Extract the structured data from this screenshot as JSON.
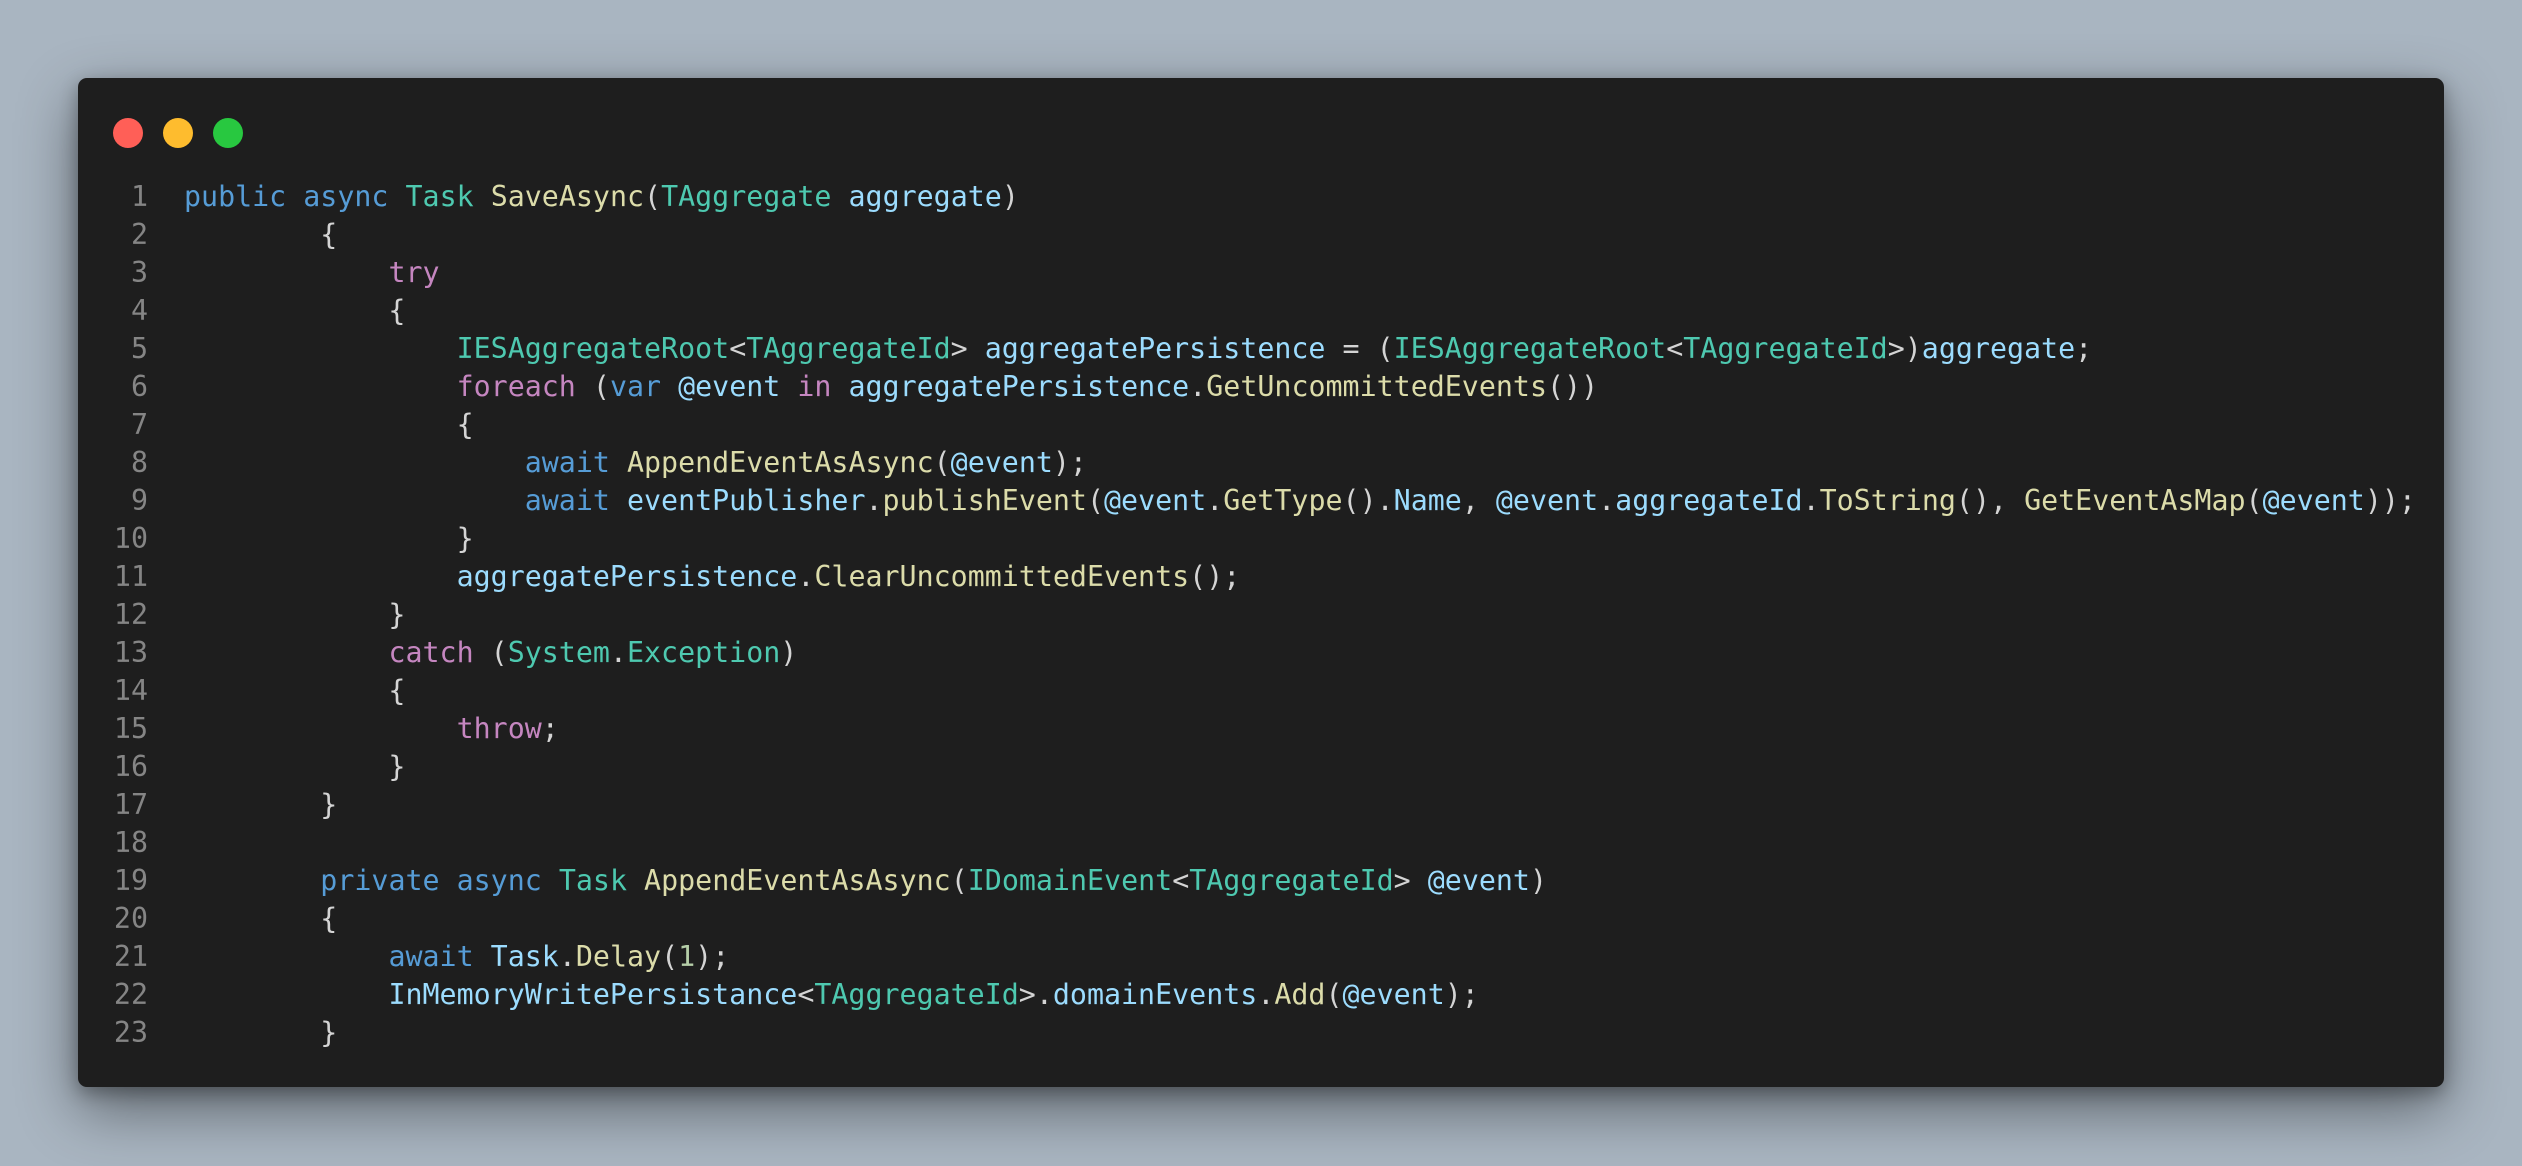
{
  "window": {
    "controls": [
      "close",
      "minimize",
      "maximize"
    ]
  },
  "colors": {
    "background": "#a9b5c1",
    "editor": "#1e1e1e",
    "close": "#ff5f57",
    "minimize": "#febc2e",
    "maximize": "#28c840",
    "keyword": "#569cd6",
    "control": "#c586c0",
    "type": "#4ec9b0",
    "function": "#dcdcaa",
    "identifier": "#9cdcfe",
    "number": "#b5cea8",
    "plain": "#d4d4d4",
    "line_number": "#858585"
  },
  "code": {
    "lines": [
      {
        "n": "1",
        "tokens": [
          [
            "kw",
            "public"
          ],
          [
            "pn",
            " "
          ],
          [
            "kw",
            "async"
          ],
          [
            "pn",
            " "
          ],
          [
            "ty",
            "Task"
          ],
          [
            "pn",
            " "
          ],
          [
            "fn",
            "SaveAsync"
          ],
          [
            "pn",
            "("
          ],
          [
            "ty",
            "TAggregate"
          ],
          [
            "pn",
            " "
          ],
          [
            "id",
            "aggregate"
          ],
          [
            "pn",
            ")"
          ]
        ]
      },
      {
        "n": "2",
        "tokens": [
          [
            "pn",
            "        {"
          ]
        ]
      },
      {
        "n": "3",
        "tokens": [
          [
            "pn",
            "            "
          ],
          [
            "ctl",
            "try"
          ]
        ]
      },
      {
        "n": "4",
        "tokens": [
          [
            "pn",
            "            {"
          ]
        ]
      },
      {
        "n": "5",
        "tokens": [
          [
            "pn",
            "                "
          ],
          [
            "ty",
            "IESAggregateRoot"
          ],
          [
            "pn",
            "<"
          ],
          [
            "ty",
            "TAggregateId"
          ],
          [
            "pn",
            "> "
          ],
          [
            "id",
            "aggregatePersistence"
          ],
          [
            "pn",
            " = ("
          ],
          [
            "ty",
            "IESAggregateRoot"
          ],
          [
            "pn",
            "<"
          ],
          [
            "ty",
            "TAggregateId"
          ],
          [
            "pn",
            ">)"
          ],
          [
            "id",
            "aggregate"
          ],
          [
            "pn",
            ";"
          ]
        ]
      },
      {
        "n": "6",
        "tokens": [
          [
            "pn",
            "                "
          ],
          [
            "ctl",
            "foreach"
          ],
          [
            "pn",
            " ("
          ],
          [
            "kw",
            "var"
          ],
          [
            "pn",
            " "
          ],
          [
            "id",
            "@event"
          ],
          [
            "pn",
            " "
          ],
          [
            "ctl",
            "in"
          ],
          [
            "pn",
            " "
          ],
          [
            "id",
            "aggregatePersistence"
          ],
          [
            "pn",
            "."
          ],
          [
            "fn",
            "GetUncommittedEvents"
          ],
          [
            "pn",
            "())"
          ]
        ]
      },
      {
        "n": "7",
        "tokens": [
          [
            "pn",
            "                {"
          ]
        ]
      },
      {
        "n": "8",
        "tokens": [
          [
            "pn",
            "                    "
          ],
          [
            "kw",
            "await"
          ],
          [
            "pn",
            " "
          ],
          [
            "fn",
            "AppendEventAsAsync"
          ],
          [
            "pn",
            "("
          ],
          [
            "id",
            "@event"
          ],
          [
            "pn",
            ");"
          ]
        ]
      },
      {
        "n": "9",
        "tokens": [
          [
            "pn",
            "                    "
          ],
          [
            "kw",
            "await"
          ],
          [
            "pn",
            " "
          ],
          [
            "id",
            "eventPublisher"
          ],
          [
            "pn",
            "."
          ],
          [
            "fn",
            "publishEvent"
          ],
          [
            "pn",
            "("
          ],
          [
            "id",
            "@event"
          ],
          [
            "pn",
            "."
          ],
          [
            "fn",
            "GetType"
          ],
          [
            "pn",
            "()."
          ],
          [
            "id",
            "Name"
          ],
          [
            "pn",
            ", "
          ],
          [
            "id",
            "@event"
          ],
          [
            "pn",
            "."
          ],
          [
            "id",
            "aggregateId"
          ],
          [
            "pn",
            "."
          ],
          [
            "fn",
            "ToString"
          ],
          [
            "pn",
            "(), "
          ],
          [
            "fn",
            "GetEventAsMap"
          ],
          [
            "pn",
            "("
          ],
          [
            "id",
            "@event"
          ],
          [
            "pn",
            "));"
          ]
        ]
      },
      {
        "n": "10",
        "tokens": [
          [
            "pn",
            "                }"
          ]
        ]
      },
      {
        "n": "11",
        "tokens": [
          [
            "pn",
            "                "
          ],
          [
            "id",
            "aggregatePersistence"
          ],
          [
            "pn",
            "."
          ],
          [
            "fn",
            "ClearUncommittedEvents"
          ],
          [
            "pn",
            "();"
          ]
        ]
      },
      {
        "n": "12",
        "tokens": [
          [
            "pn",
            "            }"
          ]
        ]
      },
      {
        "n": "13",
        "tokens": [
          [
            "pn",
            "            "
          ],
          [
            "ctl",
            "catch"
          ],
          [
            "pn",
            " ("
          ],
          [
            "ty",
            "System"
          ],
          [
            "pn",
            "."
          ],
          [
            "ty",
            "Exception"
          ],
          [
            "pn",
            ")"
          ]
        ]
      },
      {
        "n": "14",
        "tokens": [
          [
            "pn",
            "            {"
          ]
        ]
      },
      {
        "n": "15",
        "tokens": [
          [
            "pn",
            "                "
          ],
          [
            "ctl",
            "throw"
          ],
          [
            "pn",
            ";"
          ]
        ]
      },
      {
        "n": "16",
        "tokens": [
          [
            "pn",
            "            }"
          ]
        ]
      },
      {
        "n": "17",
        "tokens": [
          [
            "pn",
            "        }"
          ]
        ]
      },
      {
        "n": "18",
        "tokens": []
      },
      {
        "n": "19",
        "tokens": [
          [
            "pn",
            "        "
          ],
          [
            "kw",
            "private"
          ],
          [
            "pn",
            " "
          ],
          [
            "kw",
            "async"
          ],
          [
            "pn",
            " "
          ],
          [
            "ty",
            "Task"
          ],
          [
            "pn",
            " "
          ],
          [
            "fn",
            "AppendEventAsAsync"
          ],
          [
            "pn",
            "("
          ],
          [
            "ty",
            "IDomainEvent"
          ],
          [
            "pn",
            "<"
          ],
          [
            "ty",
            "TAggregateId"
          ],
          [
            "pn",
            "> "
          ],
          [
            "id",
            "@event"
          ],
          [
            "pn",
            ")"
          ]
        ]
      },
      {
        "n": "20",
        "tokens": [
          [
            "pn",
            "        {"
          ]
        ]
      },
      {
        "n": "21",
        "tokens": [
          [
            "pn",
            "            "
          ],
          [
            "kw",
            "await"
          ],
          [
            "pn",
            " "
          ],
          [
            "id",
            "Task"
          ],
          [
            "pn",
            "."
          ],
          [
            "fn",
            "Delay"
          ],
          [
            "pn",
            "("
          ],
          [
            "nm",
            "1"
          ],
          [
            "pn",
            ");"
          ]
        ]
      },
      {
        "n": "22",
        "tokens": [
          [
            "pn",
            "            "
          ],
          [
            "id",
            "InMemoryWritePersistance"
          ],
          [
            "pn",
            "<"
          ],
          [
            "ty",
            "TAggregateId"
          ],
          [
            "pn",
            ">."
          ],
          [
            "id",
            "domainEvents"
          ],
          [
            "pn",
            "."
          ],
          [
            "fn",
            "Add"
          ],
          [
            "pn",
            "("
          ],
          [
            "id",
            "@event"
          ],
          [
            "pn",
            ");"
          ]
        ]
      },
      {
        "n": "23",
        "tokens": [
          [
            "pn",
            "        }"
          ]
        ]
      }
    ]
  }
}
